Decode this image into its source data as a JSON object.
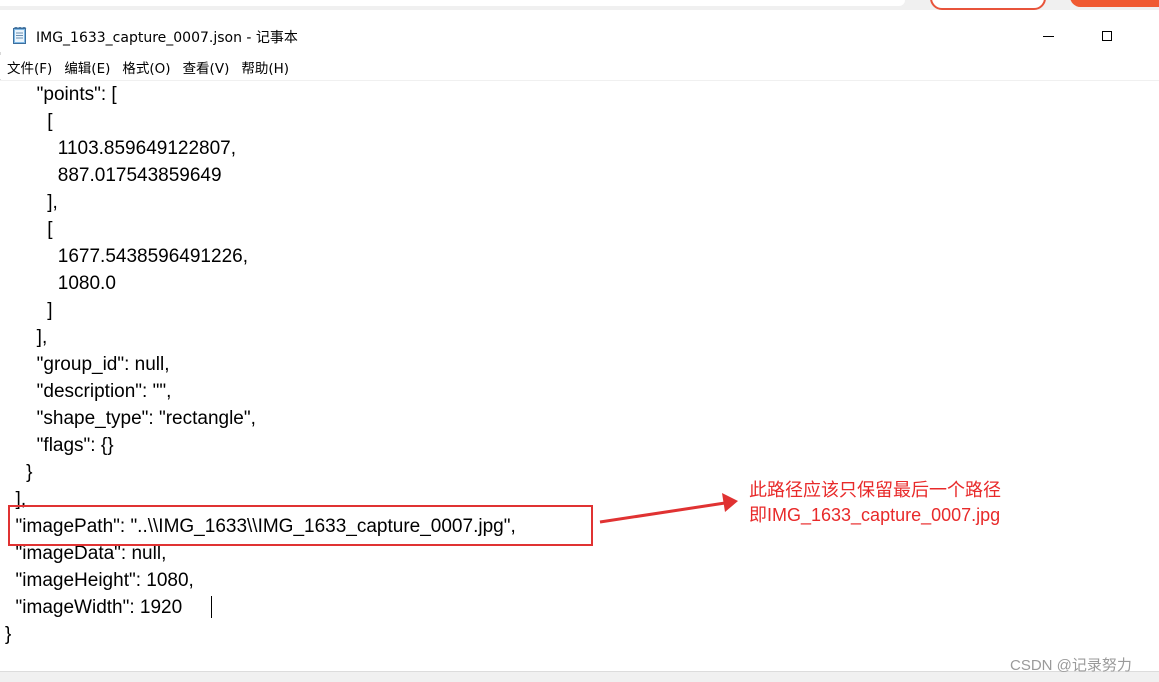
{
  "window": {
    "title": "IMG_1633_capture_0007.json - 记事本",
    "icon": "notepad-icon",
    "controls": [
      "minimize-icon",
      "maximize-icon"
    ]
  },
  "menu": {
    "file": "文件(F)",
    "edit": "编辑(E)",
    "format": "格式(O)",
    "view": "查看(V)",
    "help": "帮助(H)"
  },
  "editor": {
    "lines": [
      "      \"points\": [",
      "        [",
      "          1103.859649122807,",
      "          887.017543859649",
      "        ],",
      "        [",
      "          1677.5438596491226,",
      "          1080.0",
      "        ]",
      "      ],",
      "      \"group_id\": null,",
      "      \"description\": \"\",",
      "      \"shape_type\": \"rectangle\",",
      "      \"flags\": {}",
      "    }",
      "  ],",
      "  \"imagePath\": \"..\\\\IMG_1633\\\\IMG_1633_capture_0007.jpg\",",
      "  \"imageData\": null,",
      "  \"imageHeight\": 1080,",
      "  \"imageWidth\": 1920",
      "}"
    ]
  },
  "annotation": {
    "line1": "此路径应该只保留最后一个路径",
    "line2": "即IMG_1633_capture_0007.jpg",
    "color": "#e03232"
  },
  "watermark": "CSDN @记录努力"
}
